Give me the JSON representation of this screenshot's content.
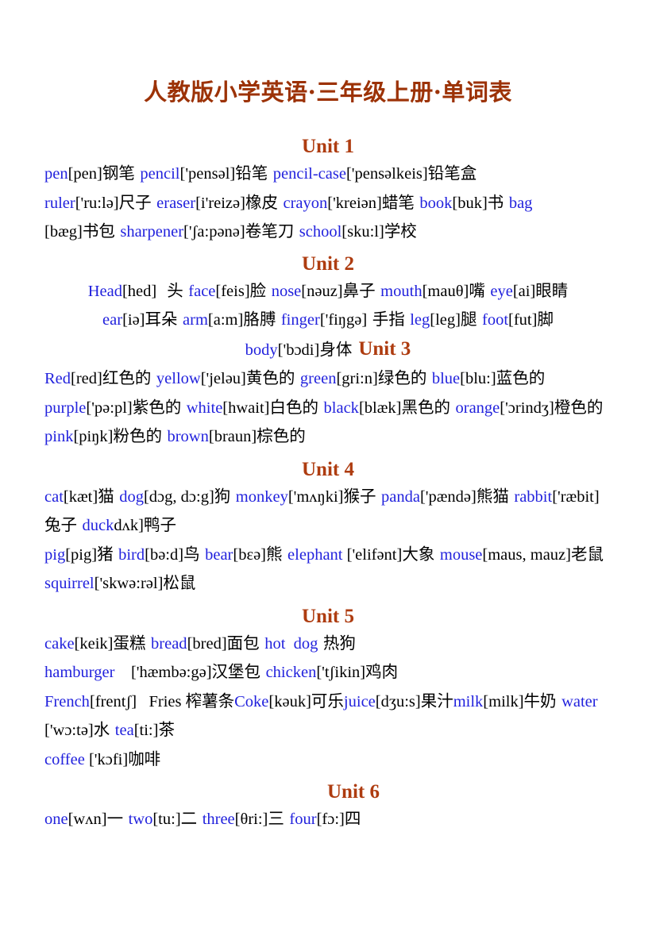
{
  "document": {
    "title": "人教版小学英语·三年级上册·单词表",
    "colors": {
      "title": "#9c3206",
      "unit_heading": "#ae3c10",
      "english_word": "#2222dd",
      "phonetic_and_chinese": "#000000",
      "page_background": "#ffffff"
    }
  },
  "units": [
    {
      "heading": "Unit 1",
      "align": "left",
      "lines": [
        [
          {
            "t": "word",
            "v": "pen"
          },
          {
            "t": "ph",
            "v": "[pen]"
          },
          {
            "t": "cn",
            "v": "钢笔 "
          },
          {
            "t": "word",
            "v": "pencil"
          },
          {
            "t": "ph",
            "v": "['pensəl]"
          },
          {
            "t": "cn",
            "v": "铅笔 "
          },
          {
            "t": "word",
            "v": "pencil-case"
          },
          {
            "t": "ph",
            "v": "['pensəlkeis]"
          },
          {
            "t": "cn",
            "v": "铅笔盒"
          }
        ],
        [
          {
            "t": "word",
            "v": "ruler"
          },
          {
            "t": "ph",
            "v": "['ru:lə]"
          },
          {
            "t": "cn",
            "v": "尺子 "
          },
          {
            "t": "word",
            "v": "eraser"
          },
          {
            "t": "ph",
            "v": "[i'reizə]"
          },
          {
            "t": "cn",
            "v": "橡皮 "
          },
          {
            "t": "word",
            "v": "crayon"
          },
          {
            "t": "ph",
            "v": "['kreiən]"
          },
          {
            "t": "cn",
            "v": "蜡笔 "
          },
          {
            "t": "word",
            "v": "book"
          },
          {
            "t": "ph",
            "v": "[buk]"
          },
          {
            "t": "cn",
            "v": "书 "
          },
          {
            "t": "word",
            "v": "bag"
          }
        ],
        [
          {
            "t": "ph",
            "v": "[bæg]"
          },
          {
            "t": "cn",
            "v": "书包 "
          },
          {
            "t": "word",
            "v": "sharpener"
          },
          {
            "t": "ph",
            "v": "['ʃa:pənə]"
          },
          {
            "t": "cn",
            "v": "卷笔刀 "
          },
          {
            "t": "word",
            "v": "school"
          },
          {
            "t": "ph",
            "v": "[sku:l]"
          },
          {
            "t": "cn",
            "v": "学校"
          }
        ]
      ]
    },
    {
      "heading": "Unit 2",
      "align": "center",
      "lines": [
        [
          {
            "t": "word",
            "v": "Head"
          },
          {
            "t": "ph",
            "v": "[hed]"
          },
          {
            "t": "cn",
            "v": "  头 "
          },
          {
            "t": "word",
            "v": "face"
          },
          {
            "t": "ph",
            "v": "[feis]"
          },
          {
            "t": "cn",
            "v": "脸 "
          },
          {
            "t": "word",
            "v": "nose"
          },
          {
            "t": "ph",
            "v": "[nəuz]"
          },
          {
            "t": "cn",
            "v": "鼻子 "
          },
          {
            "t": "word",
            "v": "mouth"
          },
          {
            "t": "ph",
            "v": "[mauθ]"
          },
          {
            "t": "cn",
            "v": "嘴 "
          },
          {
            "t": "word",
            "v": "eye"
          },
          {
            "t": "ph",
            "v": "[ai]"
          },
          {
            "t": "cn",
            "v": "眼睛"
          }
        ],
        [
          {
            "t": "word",
            "v": "ear"
          },
          {
            "t": "ph",
            "v": "[iə]"
          },
          {
            "t": "cn",
            "v": "耳朵 "
          },
          {
            "t": "word",
            "v": "arm"
          },
          {
            "t": "ph",
            "v": "[a:m]"
          },
          {
            "t": "cn",
            "v": "胳膊 "
          },
          {
            "t": "word",
            "v": "finger"
          },
          {
            "t": "ph",
            "v": "['fiŋgə]"
          },
          {
            "t": "cn",
            "v": " 手指 "
          },
          {
            "t": "word",
            "v": "leg"
          },
          {
            "t": "ph",
            "v": "[leg]"
          },
          {
            "t": "cn",
            "v": "腿 "
          },
          {
            "t": "word",
            "v": "foot"
          },
          {
            "t": "ph",
            "v": "[fut]"
          },
          {
            "t": "cn",
            "v": "脚"
          }
        ],
        [
          {
            "t": "word",
            "v": "body"
          },
          {
            "t": "ph",
            "v": "['bɔdi]"
          },
          {
            "t": "cn",
            "v": "身体"
          },
          {
            "t": "unit",
            "v": "Unit 3"
          }
        ]
      ]
    },
    {
      "heading": null,
      "align": "left",
      "lines": [
        [
          {
            "t": "word",
            "v": "Red"
          },
          {
            "t": "ph",
            "v": "[red]"
          },
          {
            "t": "cn",
            "v": "红色的 "
          },
          {
            "t": "word",
            "v": "yellow"
          },
          {
            "t": "ph",
            "v": "['jeləu]"
          },
          {
            "t": "cn",
            "v": "黄色的 "
          },
          {
            "t": "word",
            "v": "green"
          },
          {
            "t": "ph",
            "v": "[gri:n]"
          },
          {
            "t": "cn",
            "v": "绿色的 "
          },
          {
            "t": "word",
            "v": "blue"
          },
          {
            "t": "ph",
            "v": "[blu:]"
          },
          {
            "t": "cn",
            "v": "蓝色的"
          }
        ],
        [
          {
            "t": "word",
            "v": "purple"
          },
          {
            "t": "ph",
            "v": "['pə:pl]"
          },
          {
            "t": "cn",
            "v": "紫色的 "
          },
          {
            "t": "word",
            "v": "white"
          },
          {
            "t": "ph",
            "v": "[hwait]"
          },
          {
            "t": "cn",
            "v": "白色的 "
          },
          {
            "t": "word",
            "v": "black"
          },
          {
            "t": "ph",
            "v": "[blæk]"
          },
          {
            "t": "cn",
            "v": "黑色的 "
          },
          {
            "t": "word",
            "v": "orange"
          },
          {
            "t": "ph",
            "v": "['ɔrindʒ]"
          },
          {
            "t": "cn",
            "v": "橙色的 "
          },
          {
            "t": "word",
            "v": "pink"
          },
          {
            "t": "ph",
            "v": "[piŋk]"
          },
          {
            "t": "cn",
            "v": "粉色的 "
          },
          {
            "t": "word",
            "v": "brown"
          },
          {
            "t": "ph",
            "v": "[braun]"
          },
          {
            "t": "cn",
            "v": "棕色的"
          }
        ]
      ]
    },
    {
      "heading": "Unit 4",
      "align": "left",
      "lines": [
        [
          {
            "t": "word",
            "v": "cat"
          },
          {
            "t": "ph",
            "v": "[kæt]"
          },
          {
            "t": "cn",
            "v": "猫 "
          },
          {
            "t": "word",
            "v": "dog"
          },
          {
            "t": "ph",
            "v": "[dɔg, dɔ:g]"
          },
          {
            "t": "cn",
            "v": "狗 "
          },
          {
            "t": "word",
            "v": "monkey"
          },
          {
            "t": "ph",
            "v": "['mʌŋki]"
          },
          {
            "t": "cn",
            "v": "猴子 "
          },
          {
            "t": "word",
            "v": "panda"
          },
          {
            "t": "ph",
            "v": "['pændə]"
          },
          {
            "t": "cn",
            "v": "熊猫 "
          },
          {
            "t": "word",
            "v": "rabbit"
          },
          {
            "t": "ph",
            "v": "['ræbit]"
          },
          {
            "t": "cn",
            "v": "兔子 "
          },
          {
            "t": "word",
            "v": "duck"
          },
          {
            "t": "ph",
            "v": "dʌk]"
          },
          {
            "t": "cn",
            "v": "鸭子"
          }
        ],
        [
          {
            "t": "word",
            "v": "pig"
          },
          {
            "t": "ph",
            "v": "[pig]"
          },
          {
            "t": "cn",
            "v": "猪 "
          },
          {
            "t": "word",
            "v": "bird"
          },
          {
            "t": "ph",
            "v": "[bə:d]"
          },
          {
            "t": "cn",
            "v": "鸟 "
          },
          {
            "t": "word",
            "v": "bear"
          },
          {
            "t": "ph",
            "v": "[bɛə]"
          },
          {
            "t": "cn",
            "v": "熊 "
          },
          {
            "t": "word",
            "v": "elephant"
          },
          {
            "t": "ph",
            "v": " ['elifənt]"
          },
          {
            "t": "cn",
            "v": "大象 "
          },
          {
            "t": "word",
            "v": "mouse"
          },
          {
            "t": "ph",
            "v": "[maus, mauz]"
          },
          {
            "t": "cn",
            "v": "老鼠 "
          },
          {
            "t": "word",
            "v": "squirrel"
          },
          {
            "t": "ph",
            "v": "['skwə:rəl]"
          },
          {
            "t": "cn",
            "v": "松鼠"
          }
        ]
      ]
    },
    {
      "heading": "Unit 5",
      "align": "left",
      "lines": [
        [
          {
            "t": "word",
            "v": "cake"
          },
          {
            "t": "ph",
            "v": "[keik]"
          },
          {
            "t": "cn",
            "v": "蛋糕 "
          },
          {
            "t": "word",
            "v": "bread"
          },
          {
            "t": "ph",
            "v": "[bred]"
          },
          {
            "t": "cn",
            "v": "面包 "
          },
          {
            "t": "word",
            "v": "hot  dog"
          },
          {
            "t": "cn",
            "v": " 热狗"
          }
        ],
        [
          {
            "t": "word",
            "v": "hamburger"
          },
          {
            "t": "ph",
            "v": "    ['hæmbə:gə]"
          },
          {
            "t": "cn",
            "v": "汉堡包 "
          },
          {
            "t": "word",
            "v": "chicken"
          },
          {
            "t": "ph",
            "v": "['tʃikin]"
          },
          {
            "t": "cn",
            "v": "鸡肉"
          }
        ],
        [
          {
            "t": "word",
            "v": "French"
          },
          {
            "t": "ph",
            "v": "[frentʃ]"
          },
          {
            "t": "ph",
            "v": "   Fries "
          },
          {
            "t": "cn",
            "v": "榨薯条"
          },
          {
            "t": "word",
            "v": "Coke"
          },
          {
            "t": "ph",
            "v": "[kəuk]"
          },
          {
            "t": "cn",
            "v": "可乐"
          },
          {
            "t": "word",
            "v": "juice"
          },
          {
            "t": "ph",
            "v": "[dʒu:s]"
          },
          {
            "t": "cn",
            "v": "果汁"
          },
          {
            "t": "word",
            "v": "milk"
          },
          {
            "t": "ph",
            "v": "[milk]"
          },
          {
            "t": "cn",
            "v": "牛奶 "
          },
          {
            "t": "word",
            "v": "water"
          },
          {
            "t": "ph",
            "v": "['wɔ:tə]"
          },
          {
            "t": "cn",
            "v": "水 "
          },
          {
            "t": "word",
            "v": "tea"
          },
          {
            "t": "ph",
            "v": "[ti:]"
          },
          {
            "t": "cn",
            "v": "茶"
          }
        ],
        [
          {
            "t": "word",
            "v": "coffee"
          },
          {
            "t": "ph",
            "v": " ['kɔfi]"
          },
          {
            "t": "cn",
            "v": "咖啡"
          }
        ]
      ]
    },
    {
      "heading": "Unit 6",
      "align": "left",
      "lines": [
        [
          {
            "t": "word",
            "v": "one"
          },
          {
            "t": "ph",
            "v": "[wʌn]"
          },
          {
            "t": "cn",
            "v": "一 "
          },
          {
            "t": "word",
            "v": "two"
          },
          {
            "t": "ph",
            "v": "[tu:]"
          },
          {
            "t": "cn",
            "v": "二 "
          },
          {
            "t": "word",
            "v": "three"
          },
          {
            "t": "ph",
            "v": "[θri:]"
          },
          {
            "t": "cn",
            "v": "三 "
          },
          {
            "t": "word",
            "v": "four"
          },
          {
            "t": "ph",
            "v": "[fɔ:]"
          },
          {
            "t": "cn",
            "v": "四"
          }
        ]
      ]
    }
  ]
}
